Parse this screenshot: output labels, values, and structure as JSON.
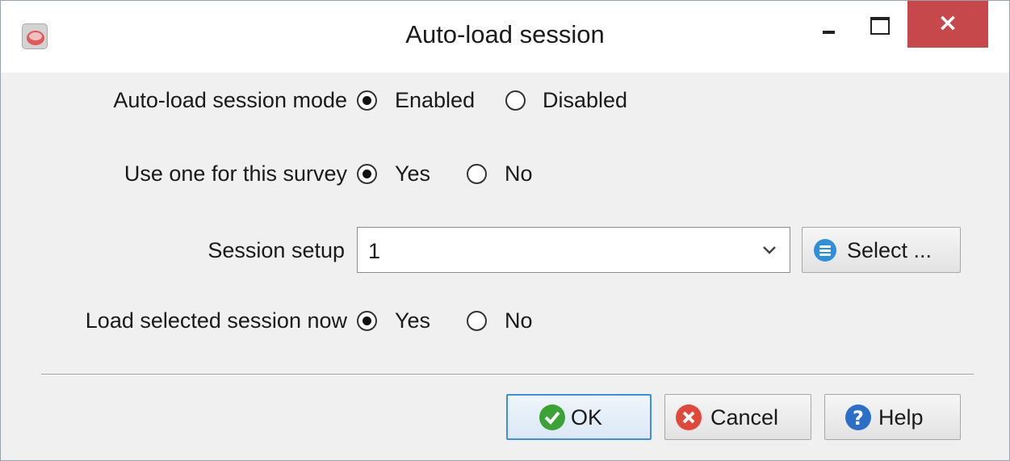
{
  "window": {
    "title": "Auto-load session",
    "close_glyph": "×",
    "icons": {
      "app": "app-icon",
      "minimize": "minimize-icon",
      "maximize": "maximize-icon",
      "close": "close-icon"
    }
  },
  "form": {
    "mode": {
      "label": "Auto-load session mode",
      "options": [
        "Enabled",
        "Disabled"
      ],
      "selected": "Enabled"
    },
    "use_one": {
      "label": "Use one for this survey",
      "options": [
        "Yes",
        "No"
      ],
      "selected": "Yes"
    },
    "session_setup": {
      "label": "Session setup",
      "value": "1",
      "select_button": "Select ...",
      "select_icon": "list-icon"
    },
    "load_now": {
      "label": "Load selected session now",
      "options": [
        "Yes",
        "No"
      ],
      "selected": "Yes"
    }
  },
  "buttons": {
    "ok": {
      "label": "OK",
      "icon": "check-icon"
    },
    "cancel": {
      "label": "Cancel",
      "icon": "cancel-icon"
    },
    "help": {
      "label": "Help",
      "icon": "help-icon"
    }
  },
  "colors": {
    "close_button": "#c7484a",
    "ok_focus_border": "#3c8fe0",
    "ok_icon": "#3aa335",
    "cancel_icon": "#e0483a",
    "help_icon": "#2b6fc9",
    "select_icon": "#2f8fdc"
  }
}
